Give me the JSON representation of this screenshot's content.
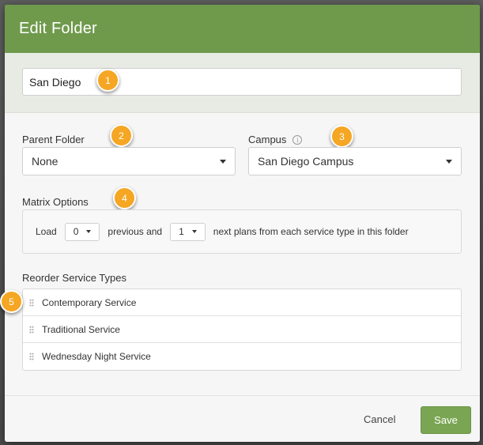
{
  "dialog": {
    "title": "Edit Folder"
  },
  "folder_name": {
    "value": "San Diego"
  },
  "parent_folder": {
    "label": "Parent Folder",
    "selected": "None"
  },
  "campus": {
    "label": "Campus",
    "info_icon": "info-icon",
    "selected": "San Diego Campus"
  },
  "matrix": {
    "label": "Matrix Options",
    "load_text": "Load",
    "previous_value": "0",
    "previous_text": "previous and",
    "next_value": "1",
    "next_text": "next plans from each service type in this folder"
  },
  "reorder": {
    "label": "Reorder Service Types",
    "items": [
      "Contemporary Service",
      "Traditional Service",
      "Wednesday Night Service"
    ]
  },
  "badges": [
    "1",
    "2",
    "3",
    "4",
    "5"
  ],
  "footer": {
    "cancel_label": "Cancel",
    "save_label": "Save"
  },
  "colors": {
    "header": "#6f9a4c",
    "save": "#7aa653",
    "badge": "#f5a623"
  }
}
